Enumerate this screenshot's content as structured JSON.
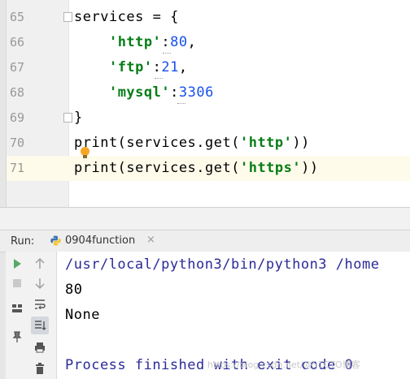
{
  "editor": {
    "lines": [
      {
        "no": "65",
        "parts": [
          {
            "t": "services = {",
            "c": "plain"
          }
        ]
      },
      {
        "no": "66",
        "parts": [
          {
            "t": "    ",
            "c": "plain"
          },
          {
            "t": "'http'",
            "c": "str"
          },
          {
            "t": ":",
            "c": "plain"
          },
          {
            "t": "80",
            "c": "num"
          },
          {
            "t": ",",
            "c": "plain"
          }
        ]
      },
      {
        "no": "67",
        "parts": [
          {
            "t": "    ",
            "c": "plain"
          },
          {
            "t": "'ftp'",
            "c": "str"
          },
          {
            "t": ":",
            "c": "plain"
          },
          {
            "t": "21",
            "c": "num"
          },
          {
            "t": ",",
            "c": "plain"
          }
        ]
      },
      {
        "no": "68",
        "parts": [
          {
            "t": "    ",
            "c": "plain"
          },
          {
            "t": "'mysql'",
            "c": "str"
          },
          {
            "t": ":",
            "c": "plain"
          },
          {
            "t": "3306",
            "c": "num"
          }
        ]
      },
      {
        "no": "69",
        "parts": [
          {
            "t": "}",
            "c": "plain"
          }
        ]
      },
      {
        "no": "70",
        "parts": [
          {
            "t": "print(services.get(",
            "c": "plain"
          },
          {
            "t": "'http'",
            "c": "str"
          },
          {
            "t": "))",
            "c": "plain"
          }
        ]
      },
      {
        "no": "71",
        "parts": [
          {
            "t": "print(services.get(",
            "c": "plain"
          },
          {
            "t": "'https'",
            "c": "str"
          },
          {
            "t": "))",
            "c": "plain"
          }
        ]
      }
    ]
  },
  "run_panel": {
    "label": "Run:",
    "tab_name": "0904function",
    "tab_close": "×"
  },
  "console": {
    "command": "/usr/local/python3/bin/python3 /home",
    "outputs": [
      "80",
      "None"
    ],
    "exit_message": "Process finished with exit code 0"
  },
  "watermark": "https://blog.csdn.net/@51CTO博客"
}
